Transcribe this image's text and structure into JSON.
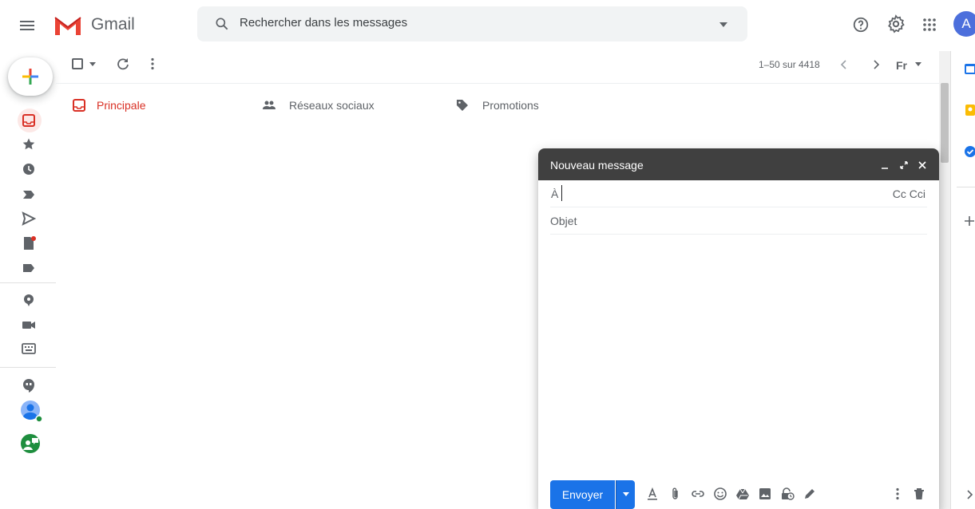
{
  "app": {
    "name": "Gmail"
  },
  "search": {
    "placeholder": "Rechercher dans les messages"
  },
  "header": {
    "avatar_letter": "A"
  },
  "toolbar": {
    "pager": "1–50 sur 4418",
    "input_tools_label": "Fr"
  },
  "tabs": [
    {
      "label": "Principale",
      "icon": "inbox-icon",
      "active": true
    },
    {
      "label": "Réseaux sociaux",
      "icon": "people-icon",
      "active": false
    },
    {
      "label": "Promotions",
      "icon": "tag-icon",
      "active": false
    }
  ],
  "rail": {
    "items": [
      "compose-icon",
      "inbox-icon",
      "star-icon",
      "clock-icon",
      "important-icon",
      "send-icon",
      "draft-icon",
      "label-icon",
      "meet-icon",
      "video-icon",
      "keyboard-icon",
      "hangouts-icon",
      "contact-icon",
      "chat-icon"
    ]
  },
  "compose": {
    "title": "Nouveau message",
    "to_label": "À",
    "cc_cci": "Cc Cci",
    "subject_placeholder": "Objet",
    "send_label": "Envoyer"
  },
  "colors": {
    "accent_red": "#d93025",
    "send_blue": "#1a73e8",
    "compose_header": "#404040",
    "avatar": "#4c6fdc"
  }
}
